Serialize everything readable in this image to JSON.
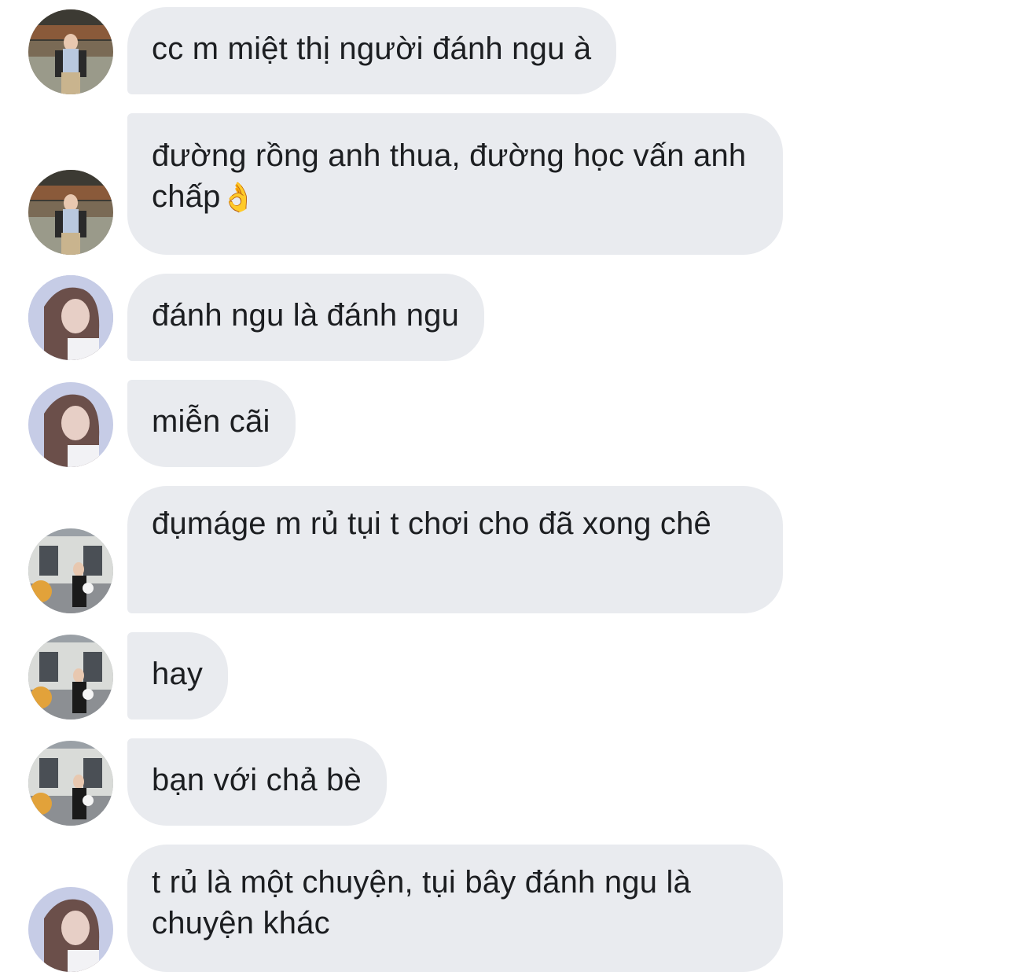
{
  "conversation": {
    "messages": [
      {
        "sender": "user-a",
        "text": "cc m miệt thị người đánh ngu à"
      },
      {
        "sender": "user-a",
        "text": "đường rồng anh thua, đường học vấn anh chấp",
        "emoji": "👌"
      },
      {
        "sender": "user-b",
        "text": "đánh ngu là đánh ngu"
      },
      {
        "sender": "user-b",
        "text": "miễn cãi"
      },
      {
        "sender": "user-c",
        "text": "đụmáge m rủ tụi t chơi cho đã xong chê"
      },
      {
        "sender": "user-c",
        "text": "hay"
      },
      {
        "sender": "user-c",
        "text": "bạn với chả bè"
      },
      {
        "sender": "user-b",
        "text": "t rủ là một chuyện, tụi bây đánh ngu là chuyện khác"
      }
    ]
  },
  "colors": {
    "bubble_bg": "#e9ebef",
    "text": "#1c1e21",
    "background": "#ffffff"
  }
}
